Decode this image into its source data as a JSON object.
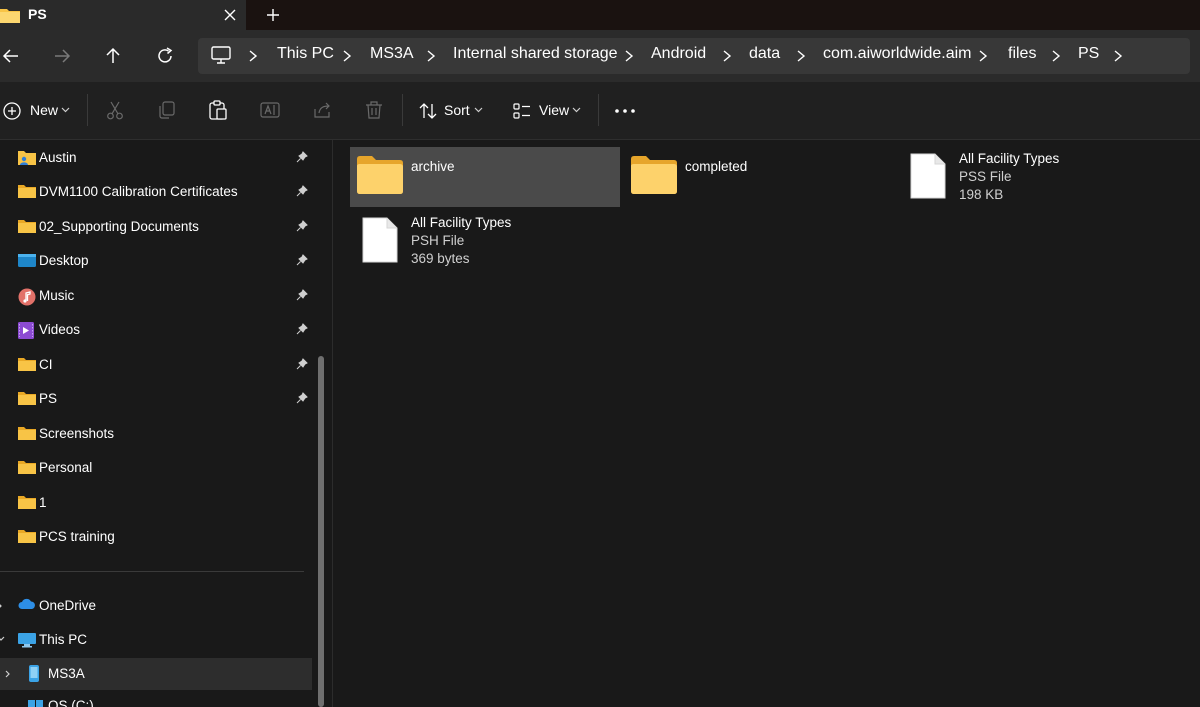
{
  "tab": {
    "title": "PS",
    "close_icon": "close-icon",
    "new_tab_icon": "plus-icon"
  },
  "breadcrumb": [
    "This PC",
    "MS3A",
    "Internal shared storage",
    "Android",
    "data",
    "com.aiworldwide.aim",
    "files",
    "PS"
  ],
  "toolbar": {
    "new_label": "New",
    "sort_label": "Sort",
    "view_label": "View",
    "icons": [
      "cut-icon",
      "copy-icon",
      "paste-icon",
      "rename-icon",
      "share-icon",
      "delete-icon",
      "more-icon"
    ]
  },
  "sidebar": {
    "quick_access": [
      {
        "label": "Austin",
        "icon": "user-folder-icon",
        "pinned": true
      },
      {
        "label": "DVM1100 Calibration Certificates",
        "icon": "folder-icon",
        "pinned": true
      },
      {
        "label": "02_Supporting Documents",
        "icon": "folder-icon",
        "pinned": true
      },
      {
        "label": "Desktop",
        "icon": "desktop-icon",
        "pinned": true
      },
      {
        "label": "Music",
        "icon": "music-icon",
        "pinned": true
      },
      {
        "label": "Videos",
        "icon": "videos-icon",
        "pinned": true
      },
      {
        "label": "CI",
        "icon": "folder-icon",
        "pinned": true
      },
      {
        "label": "PS",
        "icon": "folder-icon",
        "pinned": true
      },
      {
        "label": "Screenshots",
        "icon": "folder-icon",
        "pinned": false
      },
      {
        "label": "Personal",
        "icon": "folder-icon",
        "pinned": false
      },
      {
        "label": "1",
        "icon": "folder-icon",
        "pinned": false
      },
      {
        "label": "PCS training",
        "icon": "folder-icon",
        "pinned": false
      }
    ],
    "onedrive": "OneDrive",
    "this_pc": "This PC",
    "device": "MS3A",
    "drive_partial": "OS (C:)"
  },
  "files": [
    {
      "name": "archive",
      "type": "",
      "size": "",
      "icon": "folder-icon",
      "selected": true
    },
    {
      "name": "completed",
      "type": "",
      "size": "",
      "icon": "folder-icon",
      "selected": false
    },
    {
      "name": "All Facility Types",
      "type": "PSS File",
      "size": "198 KB",
      "icon": "file-icon",
      "selected": false
    },
    {
      "name": "All Facility Types",
      "type": "PSH File",
      "size": "369 bytes",
      "icon": "file-icon",
      "selected": false
    }
  ],
  "colors": {
    "folder": "#f8c446",
    "background": "#191919",
    "selection": "#4a4a4a",
    "address_bar": "#383838"
  }
}
